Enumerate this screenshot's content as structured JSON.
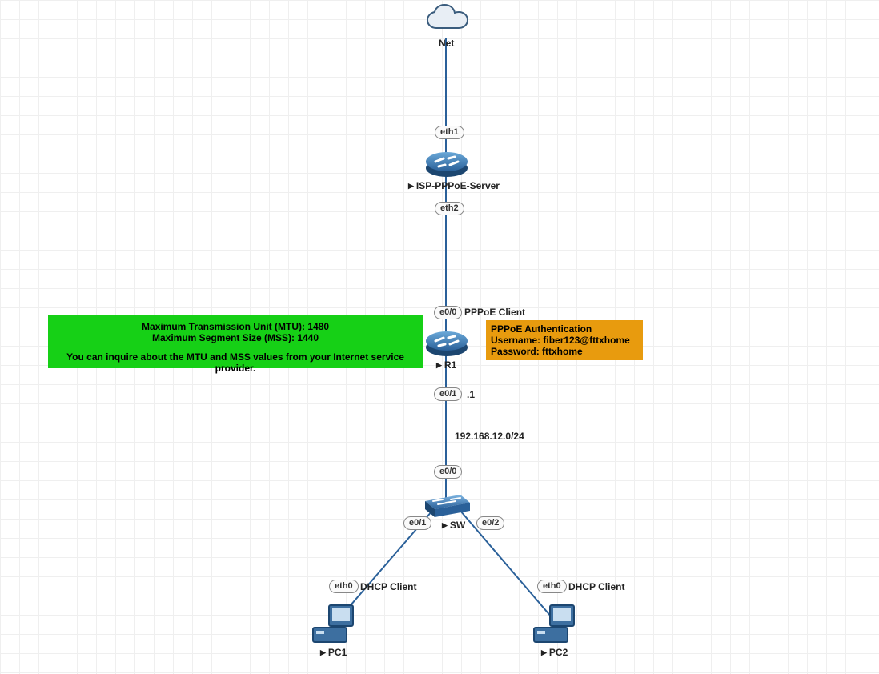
{
  "nodes": {
    "net": {
      "label": "Net"
    },
    "isp": {
      "label": "ISP-PPPoE-Server",
      "play": true
    },
    "r1": {
      "label": "R1",
      "play": true
    },
    "sw": {
      "label": "SW",
      "play": true
    },
    "pc1": {
      "label": "PC1",
      "play": true
    },
    "pc2": {
      "label": "PC2",
      "play": true
    }
  },
  "ifaces": {
    "isp_eth1": "eth1",
    "isp_eth2": "eth2",
    "r1_e00": "e0/0",
    "r1_e01": "e0/1",
    "sw_e00": "e0/0",
    "sw_e01": "e0/1",
    "sw_e02": "e0/2",
    "pc1_eth0": "eth0",
    "pc2_eth0": "eth0"
  },
  "annot": {
    "pppoe_client": "PPPoE Client",
    "dot1": ".1",
    "subnet": "192.168.12.0/24",
    "dhcp": "DHCP Client"
  },
  "mtu": {
    "l1": "Maximum Transmission Unit (MTU): 1480",
    "l2": "Maximum Segment Size (MSS): 1440",
    "l3": "You can inquire about the MTU and MSS values from your Internet service provider."
  },
  "auth": {
    "l1": "PPPoE Authentication",
    "l2": "Username: fiber123@fttxhome",
    "l3": "Password: fttxhome"
  }
}
